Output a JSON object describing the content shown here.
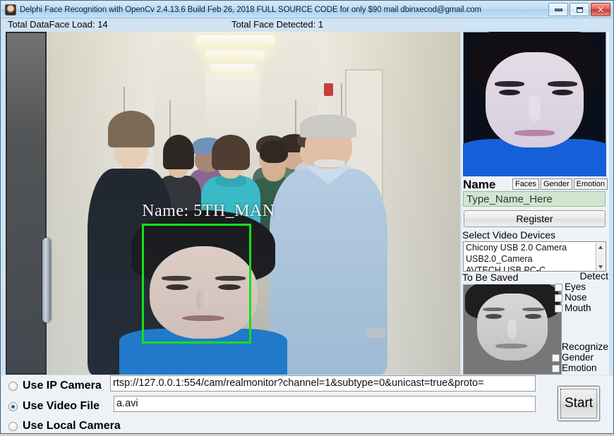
{
  "window": {
    "title": "Delphi Face Recognition with OpenCv 2.4.13.6 Build Feb 26, 2018 FULL SOURCE CODE for only $90 mail dbinxecod@gmail.com",
    "icon": "face-avatar-icon",
    "minimize_label": "Minimize",
    "maximize_label": "Maximize",
    "close_label": "Close"
  },
  "status": {
    "dataface_load": "Total DataFace Load: 14",
    "face_detected": "Total Face Detected: 1"
  },
  "video": {
    "overlay_label": "Name: 5TH_MAN",
    "box_color": "#17e017",
    "scene_description": "hallway with group of people walking toward camera"
  },
  "right_panel": {
    "preview_caption": "detected-face-preview",
    "name_label": "Name",
    "toggles": [
      {
        "id": "faces",
        "label": "Faces"
      },
      {
        "id": "gender",
        "label": "Gender"
      },
      {
        "id": "emotion",
        "label": "Emotion"
      }
    ],
    "name_value": "Type_Name_Here",
    "name_placeholder": "Type_Name_Here",
    "register_label": "Register",
    "devices_label": "Select Video Devices",
    "devices": [
      "Chicony USB 2.0 Camera",
      "USB2.0_Camera",
      "AVTECH USB PC-C"
    ],
    "to_be_saved_label": "To Be Saved",
    "detect_group": {
      "title": "Detect",
      "items": [
        {
          "label": "Eyes",
          "checked": false
        },
        {
          "label": "Nose",
          "checked": false
        },
        {
          "label": "Mouth",
          "checked": false
        }
      ]
    },
    "recognize_group": {
      "title": "Recognize",
      "items": [
        {
          "label": "Gender",
          "checked": false
        },
        {
          "label": "Emotion",
          "checked": false
        }
      ]
    }
  },
  "sources": {
    "options": [
      {
        "id": "ip",
        "label": "Use IP Camera",
        "selected": false
      },
      {
        "id": "file",
        "label": "Use Video File",
        "selected": true
      },
      {
        "id": "local",
        "label": "Use Local Camera",
        "selected": false
      }
    ],
    "ip_url": "rtsp://127.0.0.1:554/cam/realmonitor?channel=1&subtype=0&unicast=true&proto=",
    "file_path": "a.avi",
    "start_label": "Start"
  },
  "colors": {
    "titlebar": "#bfdcf3",
    "panel": "#eef2f6",
    "accent_green": "#17e017",
    "name_field_bg": "#d2e6cf",
    "close_button": "#c73a2c"
  }
}
